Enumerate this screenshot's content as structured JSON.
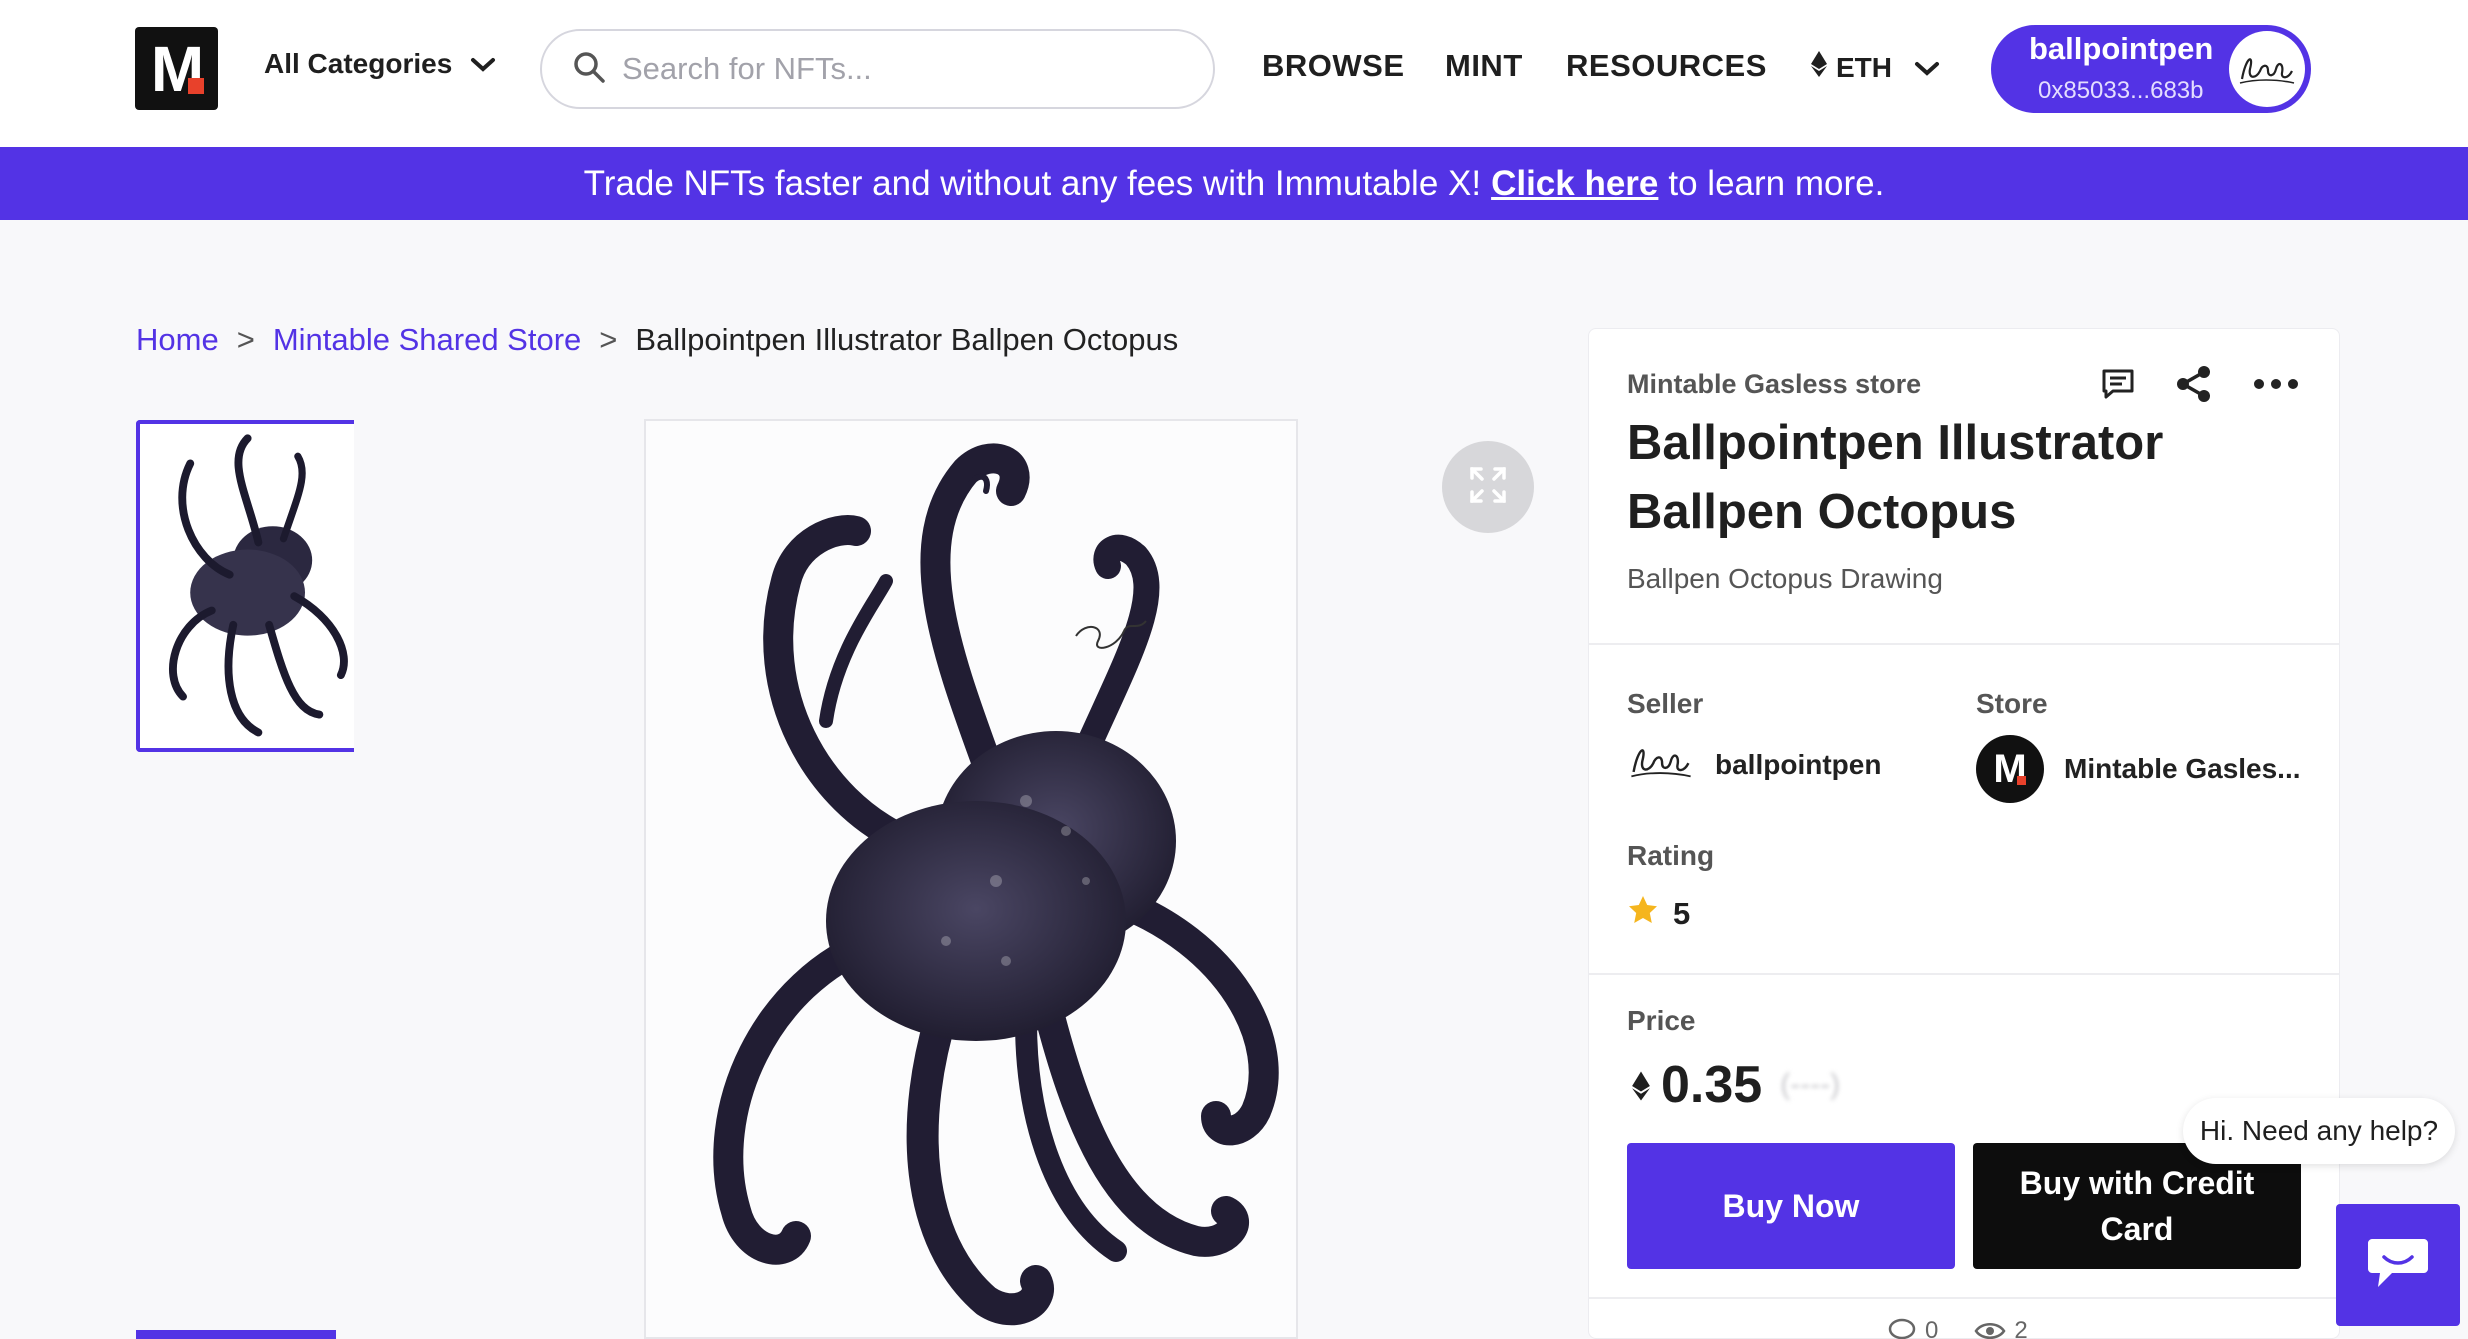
{
  "header": {
    "categories_label": "All Categories",
    "search_placeholder": "Search for NFTs...",
    "nav": {
      "browse": "BROWSE",
      "mint": "MINT",
      "resources": "RESOURCES"
    },
    "currency": "ETH",
    "account": {
      "name": "ballpointpen",
      "address": "0x85033...683b"
    }
  },
  "banner": {
    "text_before": "Trade NFTs faster and without any fees with Immutable X!",
    "link_text": "Click here",
    "text_after": "to learn more."
  },
  "breadcrumb": {
    "home": "Home",
    "store": "Mintable Shared Store",
    "current": "Ballpointpen Illustrator Ballpen Octopus"
  },
  "item": {
    "store_label": "Mintable Gasless store",
    "title": "Ballpointpen Illustrator Ballpen Octopus",
    "subtitle": "Ballpen Octopus Drawing",
    "seller_label": "Seller",
    "seller_name": "ballpointpen",
    "store_field_label": "Store",
    "store_name": "Mintable Gasles...",
    "rating_label": "Rating",
    "rating_value": "5",
    "price_label": "Price",
    "price_value": "0.35",
    "buy_now_label": "Buy Now",
    "buy_card_label": "Buy with Credit Card",
    "comments_count": "0",
    "views_count": "2"
  },
  "chat": {
    "greeting": "Hi. Need any help?"
  },
  "icons": {
    "search": "search-icon",
    "chevron": "chevron-down-icon",
    "eth": "eth-icon",
    "expand": "expand-icon",
    "comment": "comment-icon",
    "share": "share-icon",
    "more": "more-icon",
    "star": "star-icon",
    "chat": "chat-icon"
  },
  "colors": {
    "accent": "#5333e5",
    "dark": "#0d0d0d",
    "star": "#f5b51e"
  }
}
